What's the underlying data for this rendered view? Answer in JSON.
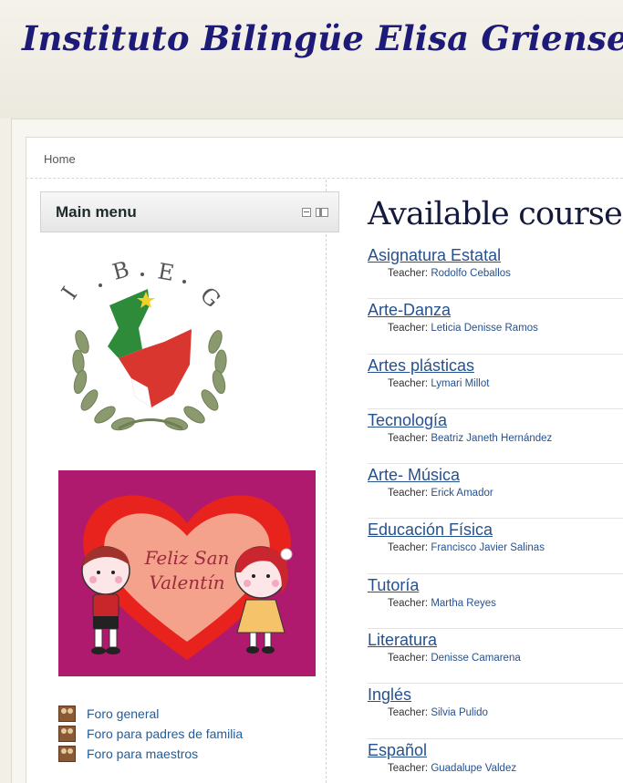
{
  "site": {
    "title": "Instituto Bilingüe Elisa Griensen"
  },
  "breadcrumb": {
    "home": "Home"
  },
  "main_menu": {
    "title": "Main menu",
    "logo_letters": [
      "I",
      "B",
      "E",
      "G"
    ],
    "valentine_text": [
      "Feliz San",
      "Valentín"
    ],
    "forums": [
      {
        "label": "Foro general"
      },
      {
        "label": "Foro para padres de familia"
      },
      {
        "label": "Foro para maestros"
      }
    ]
  },
  "courses": {
    "heading": "Available courses",
    "teacher_label": "Teacher:",
    "items": [
      {
        "name": "Asignatura Estatal",
        "teacher": "Rodolfo Ceballos"
      },
      {
        "name": "Arte-Danza",
        "teacher": "Leticia Denisse Ramos"
      },
      {
        "name": "Artes plásticas",
        "teacher": "Lymari Millot"
      },
      {
        "name": "Tecnología",
        "teacher": "Beatriz Janeth Hernández"
      },
      {
        "name": "Arte- Música",
        "teacher": "Erick Amador"
      },
      {
        "name": "Educación Física",
        "teacher": "Francisco Javier Salinas"
      },
      {
        "name": "Tutoría",
        "teacher": "Martha Reyes"
      },
      {
        "name": "Literatura",
        "teacher": "Denisse Camarena"
      },
      {
        "name": "Inglés",
        "teacher": "Silvia Pulido"
      },
      {
        "name": "Español",
        "teacher": "Guadalupe Valdez"
      }
    ]
  },
  "colors": {
    "title": "#1e1a78",
    "link": "#26518f",
    "valentine_bg": "#b01a6e",
    "heart_outer": "#e8221c",
    "heart_inner": "#f4a28c"
  }
}
